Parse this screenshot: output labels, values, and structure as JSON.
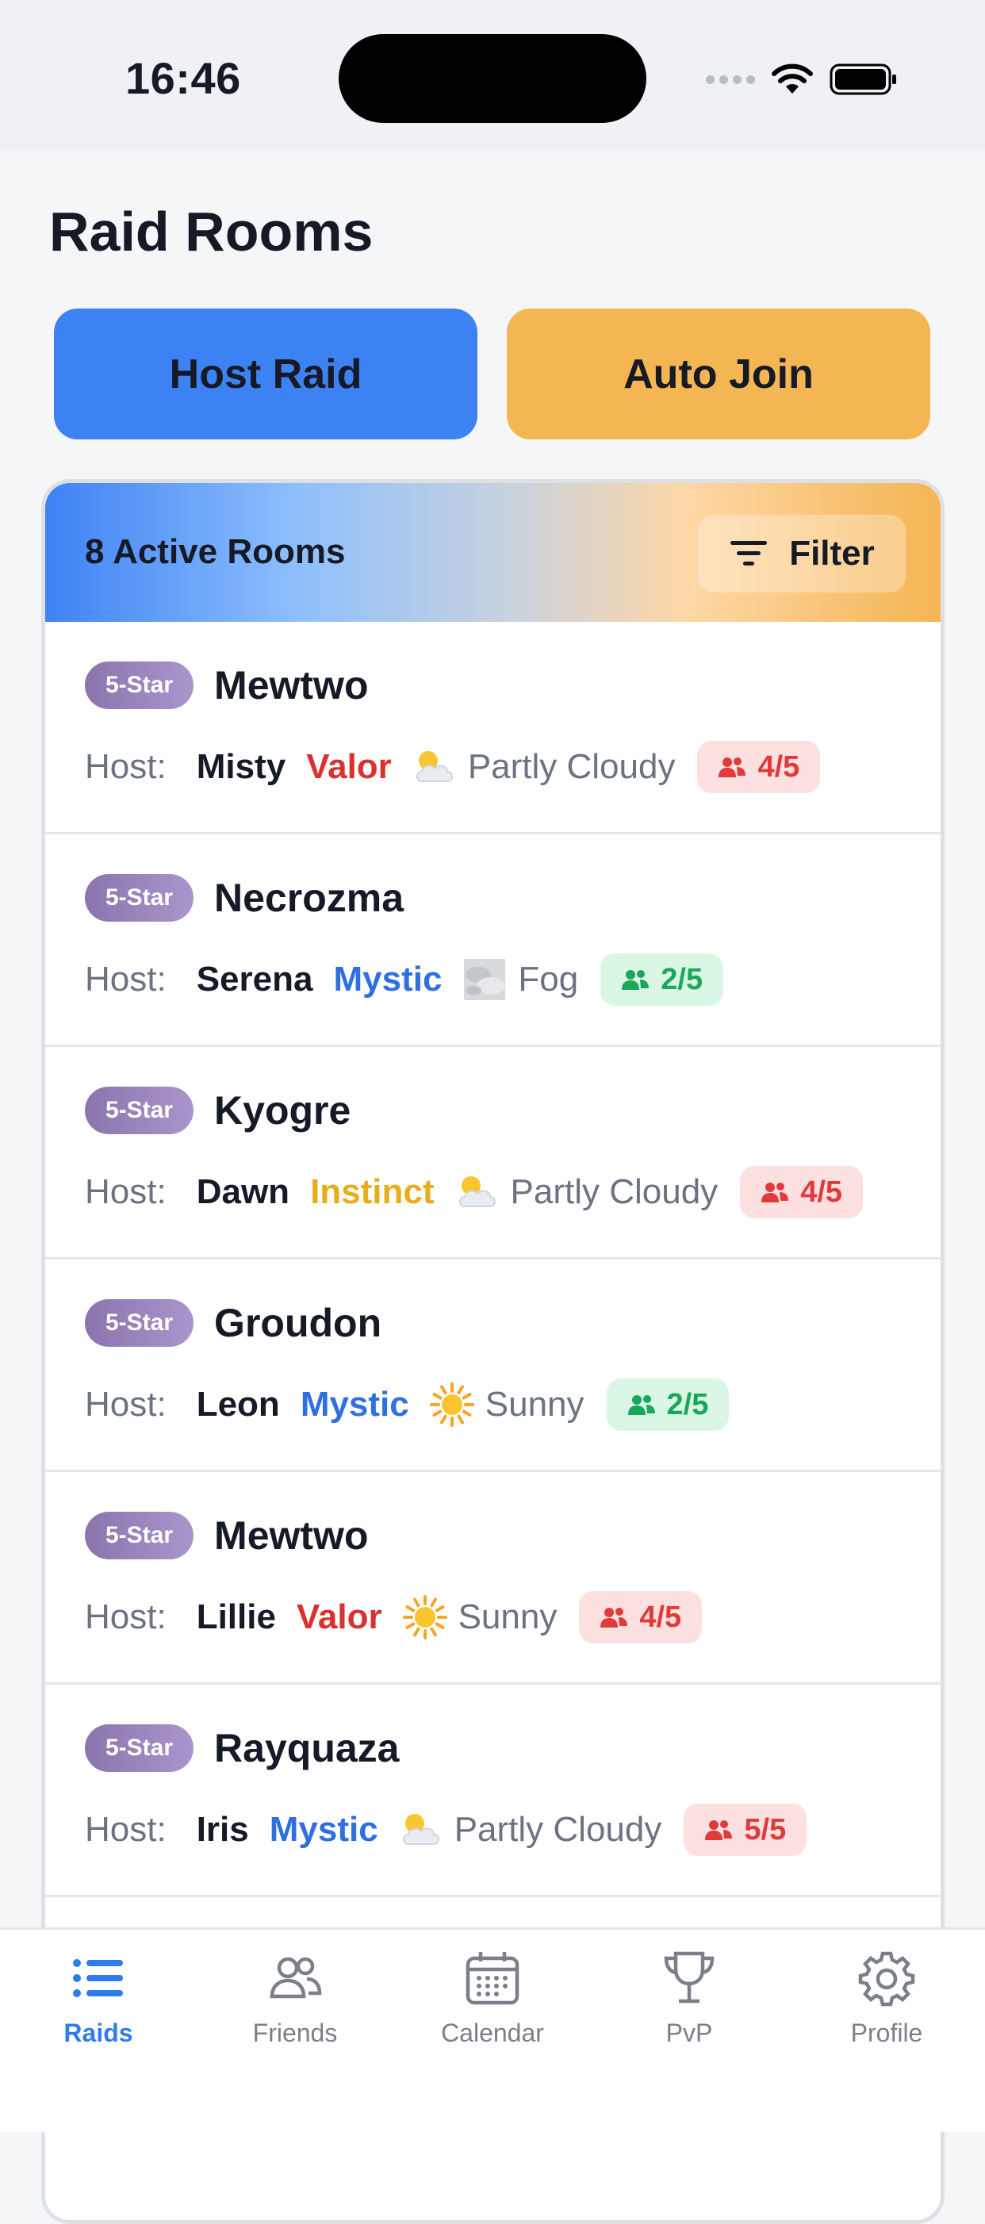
{
  "status_bar": {
    "time": "16:46"
  },
  "page_title": "Raid Rooms",
  "actions": {
    "host_label": "Host Raid",
    "auto_label": "Auto Join"
  },
  "list_header": {
    "active_label": "8 Active Rooms",
    "filter_label": "Filter"
  },
  "rooms": [
    {
      "tier": "5-Star",
      "pokemon": "Mewtwo",
      "host_label": "Host:",
      "host": "Misty",
      "team": "Valor",
      "team_color": "#d93030",
      "weather_icon": "partly-cloudy-icon",
      "weather": "Partly Cloudy",
      "players": "4/5",
      "status": "full"
    },
    {
      "tier": "5-Star",
      "pokemon": "Necrozma",
      "host_label": "Host:",
      "host": "Serena",
      "team": "Mystic",
      "team_color": "#2f6fe0",
      "weather_icon": "fog-icon",
      "weather": "Fog",
      "players": "2/5",
      "status": "open"
    },
    {
      "tier": "5-Star",
      "pokemon": "Kyogre",
      "host_label": "Host:",
      "host": "Dawn",
      "team": "Instinct",
      "team_color": "#e9ad1c",
      "weather_icon": "partly-cloudy-icon",
      "weather": "Partly Cloudy",
      "players": "4/5",
      "status": "full"
    },
    {
      "tier": "5-Star",
      "pokemon": "Groudon",
      "host_label": "Host:",
      "host": "Leon",
      "team": "Mystic",
      "team_color": "#2f6fe0",
      "weather_icon": "sunny-icon",
      "weather": "Sunny",
      "players": "2/5",
      "status": "open"
    },
    {
      "tier": "5-Star",
      "pokemon": "Mewtwo",
      "host_label": "Host:",
      "host": "Lillie",
      "team": "Valor",
      "team_color": "#d93030",
      "weather_icon": "sunny-icon",
      "weather": "Sunny",
      "players": "4/5",
      "status": "full"
    },
    {
      "tier": "5-Star",
      "pokemon": "Rayquaza",
      "host_label": "Host:",
      "host": "Iris",
      "team": "Mystic",
      "team_color": "#2f6fe0",
      "weather_icon": "partly-cloudy-icon",
      "weather": "Partly Cloudy",
      "players": "5/5",
      "status": "full"
    }
  ],
  "tabs": [
    {
      "label": "Raids",
      "icon": "list-icon",
      "active": true
    },
    {
      "label": "Friends",
      "icon": "friends-icon",
      "active": false
    },
    {
      "label": "Calendar",
      "icon": "calendar-icon",
      "active": false
    },
    {
      "label": "PvP",
      "icon": "trophy-icon",
      "active": false
    },
    {
      "label": "Profile",
      "icon": "gear-icon",
      "active": false
    }
  ],
  "colors": {
    "accent_blue": "#3d82f3",
    "accent_orange": "#f4b553",
    "full": "#e03a3a",
    "open": "#1ba75a"
  }
}
